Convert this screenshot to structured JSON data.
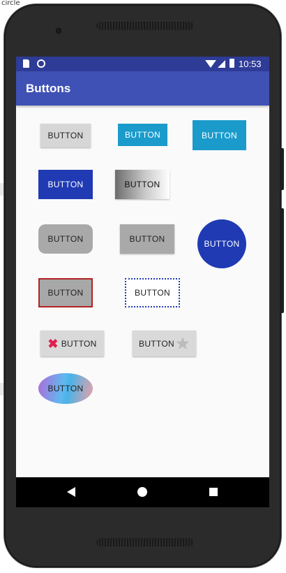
{
  "background_window": {
    "title_fragment": "circle"
  },
  "status_bar": {
    "time": "10:53",
    "icons": [
      "sd-card-icon",
      "sync-icon",
      "wifi-icon",
      "signal-icon",
      "battery-icon"
    ]
  },
  "app_bar": {
    "title": "Buttons"
  },
  "buttons": {
    "default_button": "BUTTON",
    "cyan_small_button": "BUTTON",
    "cyan_large_button": "BUTTON",
    "blue_button": "BUTTON",
    "gradient_button": "BUTTON",
    "rounded_gray_button": "BUTTON",
    "gray_button": "BUTTON",
    "circle_button": "BUTTON",
    "red_border_button": "BUTTON",
    "dotted_border_button": "BUTTON",
    "close_icon_button": "BUTTON",
    "star_icon_button": "BUTTON",
    "oval_gradient_button": "BUTTON"
  },
  "colors": {
    "status_bar": "#2e3b97",
    "app_bar": "#3f51b5",
    "cyan": "#1a9bcb",
    "blue": "#1f3ab3",
    "red_border": "#b22222",
    "close_icon": "#e0204f"
  },
  "nav_bar": {
    "icons": [
      "back-icon",
      "home-icon",
      "recent-apps-icon"
    ]
  }
}
